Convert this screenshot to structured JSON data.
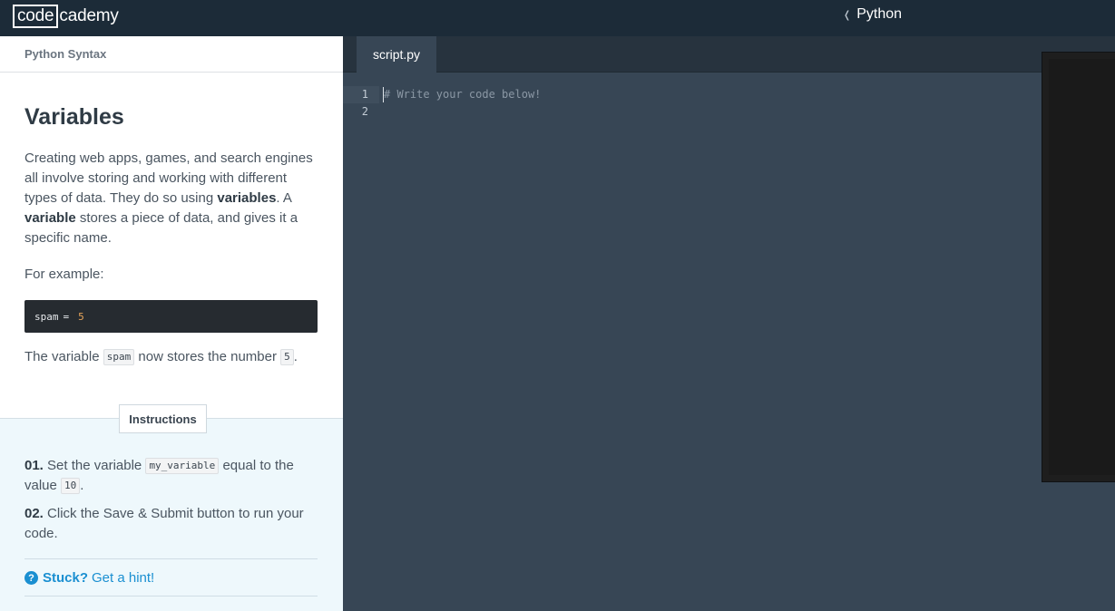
{
  "topbar": {
    "logo_box": "code",
    "logo_rest": "cademy",
    "breadcrumb": "Python"
  },
  "lesson": {
    "header": "Python Syntax",
    "title": "Variables",
    "para1_text": "Creating web apps, games, and search engines all involve storing and working with different types of data. They do so using ",
    "para1_bold1": "variables",
    "para1_mid": ". A ",
    "para1_bold2": "variable",
    "para1_end": " stores a piece of data, and gives it a specific name.",
    "example_label": "For example:",
    "code_var": "spam",
    "code_op": "=",
    "code_num": "5",
    "para3_start": "The variable ",
    "para3_code1": "spam",
    "para3_mid": " now stores the number ",
    "para3_code2": "5",
    "para3_end": "."
  },
  "instructions": {
    "tab_label": "Instructions",
    "step1_num": "01.",
    "step1_start": " Set the variable ",
    "step1_code": "my_variable",
    "step1_mid": " equal to the value ",
    "step1_code2": "10",
    "step1_end": ".",
    "step2_num": "02.",
    "step2_text": " Click the Save & Submit button to run your code.",
    "hint_icon": "?",
    "hint_bold": "Stuck?",
    "hint_text": "Get a hint!"
  },
  "editor": {
    "file_tab": "script.py",
    "line_numbers": [
      "1",
      "2"
    ],
    "line1": "# Write your code below!"
  }
}
